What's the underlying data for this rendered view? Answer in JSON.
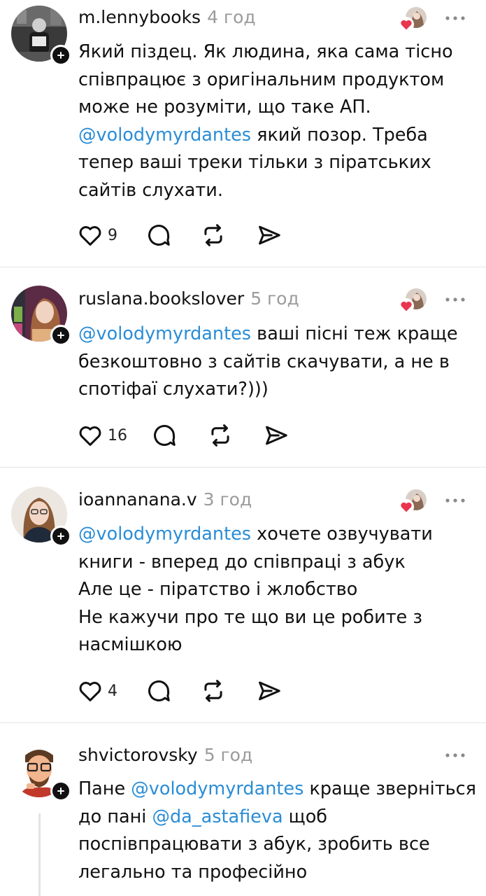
{
  "posts": [
    {
      "username": "m.lennybooks",
      "time": "4 год",
      "lines": [
        [
          {
            "t": "Який піздец. Як людина, яка сама тісно"
          }
        ],
        [
          {
            "t": "співпрацює з оригінальним продуктом"
          }
        ],
        [
          {
            "t": "може не розуміти, що таке АП."
          }
        ],
        [
          {
            "t": "@volodymyrdantes",
            "m": true
          },
          {
            "t": " який позор. Треба"
          }
        ],
        [
          {
            "t": "тепер ваші треки тільки з піратських"
          }
        ],
        [
          {
            "t": "сайтів слухати."
          }
        ]
      ],
      "likes": "9"
    },
    {
      "username": "ruslana.bookslover",
      "time": "5 год",
      "lines": [
        [
          {
            "t": "@volodymyrdantes",
            "m": true
          },
          {
            "t": " ваші пісні теж краще"
          }
        ],
        [
          {
            "t": "безкоштовно з сайтів скачувати, а не в"
          }
        ],
        [
          {
            "t": "спотіфаї слухати?)))"
          }
        ]
      ],
      "likes": "16"
    },
    {
      "username": "ioannanana.v",
      "time": "3 год",
      "lines": [
        [
          {
            "t": "@volodymyrdantes",
            "m": true
          },
          {
            "t": " хочете озвучувати"
          }
        ],
        [
          {
            "t": "книги - вперед до співпраці з абук"
          }
        ],
        [
          {
            "t": "Але це - піратство і жлобство"
          }
        ],
        [
          {
            "t": "Не кажучи про те що ви це робите з"
          }
        ],
        [
          {
            "t": "насмішкою"
          }
        ]
      ],
      "likes": "4"
    },
    {
      "username": "shvictorovsky",
      "time": "5 год",
      "lines": [
        [
          {
            "t": "Пане "
          },
          {
            "t": "@volodymyrdantes",
            "m": true
          },
          {
            "t": " краще зверніться"
          }
        ],
        [
          {
            "t": "до пані "
          },
          {
            "t": "@da_astafieva",
            "m": true
          },
          {
            "t": " щоб"
          }
        ],
        [
          {
            "t": "поспівпрацювати з абук, зробить все"
          }
        ],
        [
          {
            "t": "легально та професійно"
          }
        ]
      ]
    }
  ],
  "colors": {
    "mention": "#2a8dd6",
    "heart_badge": "#e8364e",
    "divider": "#e5e5e5",
    "time": "#9b9b9b"
  },
  "icons": {
    "like": "heart-outline-icon",
    "reply": "comment-bubble-icon",
    "repost": "repost-arrows-icon",
    "share": "send-paper-plane-icon",
    "more": "more-dots-icon",
    "follow": "plus-icon"
  }
}
